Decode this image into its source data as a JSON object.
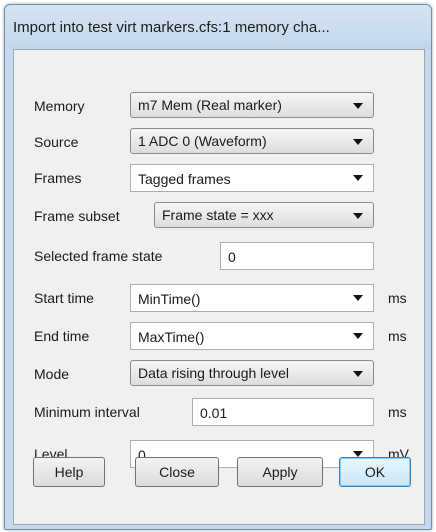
{
  "window": {
    "title": "Import into test virt markers.cfs:1 memory cha..."
  },
  "fields": {
    "memory": {
      "label": "Memory",
      "value": "m7 Mem (Real marker)"
    },
    "source": {
      "label": "Source",
      "value": "1 ADC 0 (Waveform)"
    },
    "frames": {
      "label": "Frames",
      "value": "Tagged frames"
    },
    "frame_subset": {
      "label": "Frame subset",
      "value": "Frame state = xxx"
    },
    "selected_frame_state": {
      "label": "Selected frame state",
      "value": "0"
    },
    "start_time": {
      "label": "Start time",
      "value": "MinTime()",
      "unit": "ms"
    },
    "end_time": {
      "label": "End time",
      "value": "MaxTime()",
      "unit": "ms"
    },
    "mode": {
      "label": "Mode",
      "value": "Data rising through level"
    },
    "minimum_interval": {
      "label": "Minimum interval",
      "value": "0.01",
      "unit": "ms"
    },
    "level": {
      "label": "Level",
      "value": "0",
      "unit": "mV"
    }
  },
  "buttons": {
    "help": "Help",
    "close": "Close",
    "apply": "Apply",
    "ok": "OK"
  }
}
